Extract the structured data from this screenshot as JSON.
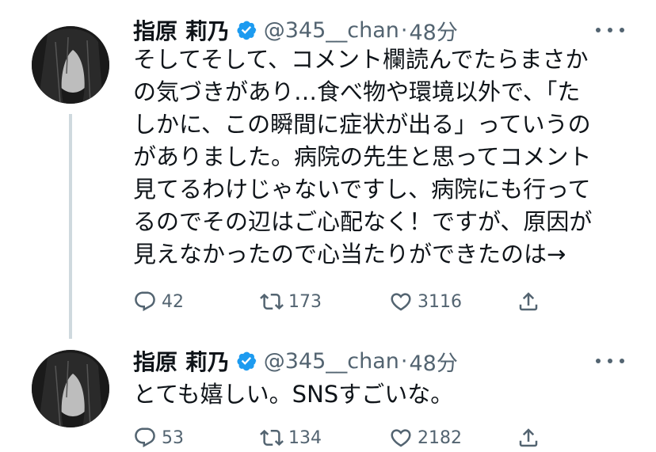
{
  "tweets": [
    {
      "display_name": "指原 莉乃",
      "handle": "@345__chan",
      "separator": "·",
      "time": "48分",
      "text": "そしてそして、コメント欄読んでたらまさか\nの気づきがあり…食べ物や環境以外で、「た\nしかに、この瞬間に症状が出る」っていうの\nがありました。病院の先生と思ってコメント\n見てるわけじゃないですし、病院にも行って\nるのでその辺はご心配なく！ですが、原因が\n見えなかったので心当たりができたのは→",
      "replies": "42",
      "retweets": "173",
      "likes": "3116",
      "icons": [
        "avatar-photo",
        "verified-badge-icon",
        "more-icon",
        "reply-icon",
        "retweet-icon",
        "like-icon",
        "share-icon"
      ]
    },
    {
      "display_name": "指原 莉乃",
      "handle": "@345__chan",
      "separator": "·",
      "time": "48分",
      "text": "とても嬉しい。SNSすごいな。",
      "replies": "53",
      "retweets": "134",
      "likes": "2182",
      "icons": [
        "avatar-photo",
        "verified-badge-icon",
        "more-icon",
        "reply-icon",
        "retweet-icon",
        "like-icon",
        "share-icon"
      ]
    }
  ],
  "colors": {
    "verified": "#1d9bf0",
    "secondary_text": "#536471",
    "thread_line": "#cfd9de"
  }
}
